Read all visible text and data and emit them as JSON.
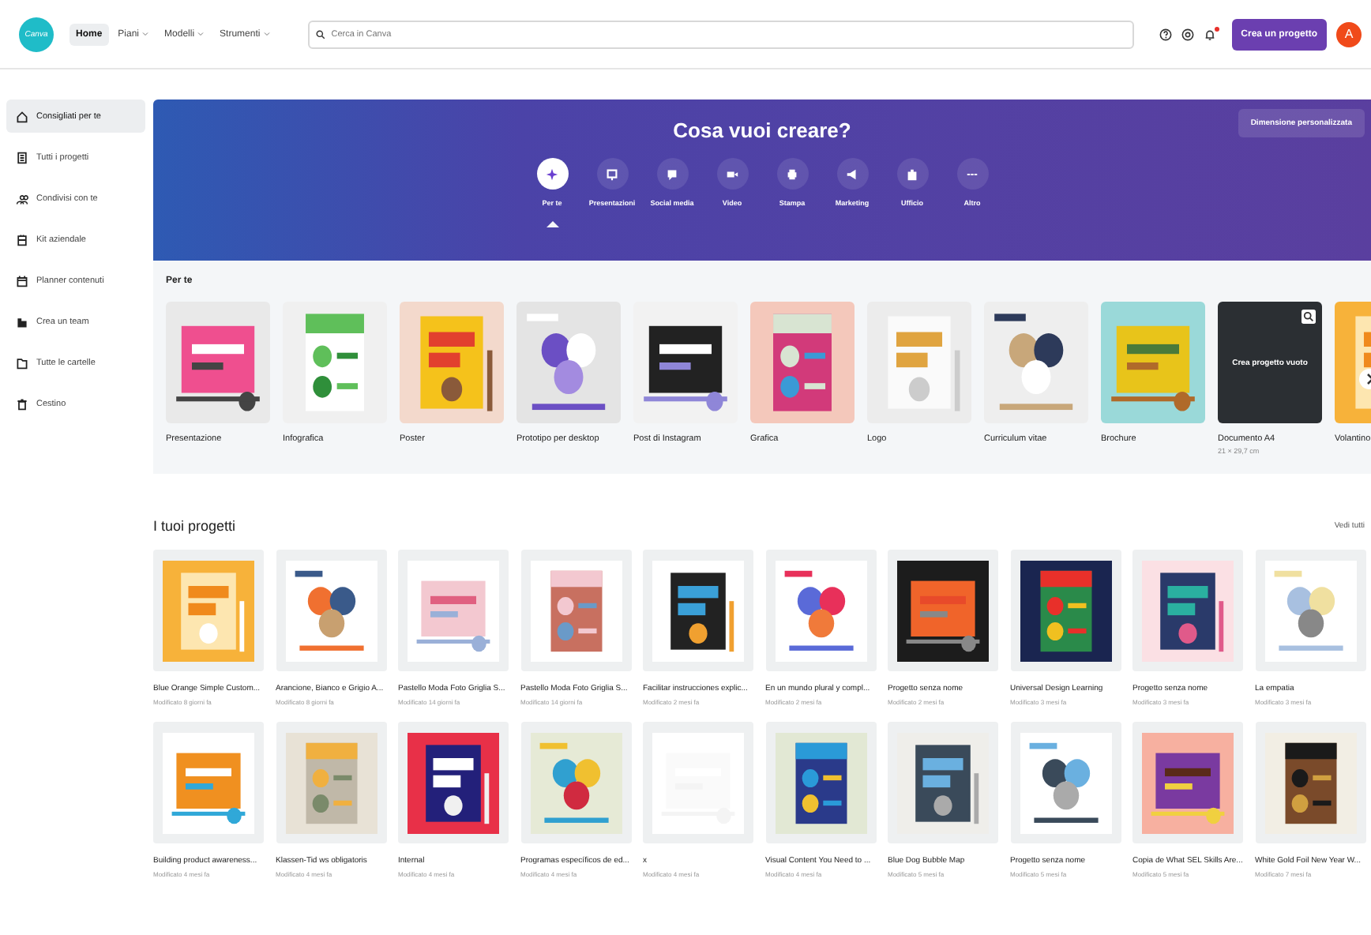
{
  "header": {
    "logo": "Canva",
    "nav": [
      {
        "label": "Home",
        "selected": true,
        "dropdown": false
      },
      {
        "label": "Piani",
        "selected": false,
        "dropdown": true
      },
      {
        "label": "Modelli",
        "selected": false,
        "dropdown": true
      },
      {
        "label": "Strumenti",
        "selected": false,
        "dropdown": true
      }
    ],
    "search": {
      "placeholder": "Cerca in Canva"
    },
    "has_notification": true,
    "create_button": "Crea un progetto",
    "avatar": "A"
  },
  "sidebar": {
    "items": [
      {
        "label": "Consigliati per te",
        "selected": true
      },
      {
        "label": "Tutti i progetti",
        "selected": false
      },
      {
        "label": "Condivisi con te",
        "selected": false
      },
      {
        "label": "Kit aziendale",
        "selected": false
      },
      {
        "label": "Planner contenuti",
        "selected": false
      },
      {
        "label": "Crea un team",
        "selected": false
      },
      {
        "label": "Tutte le cartelle",
        "selected": false
      },
      {
        "label": "Cestino",
        "selected": false
      }
    ]
  },
  "banner": {
    "title": "Cosa vuoi creare?",
    "custom_size_button": "Dimensione personalizzata",
    "categories": [
      {
        "label": "Per te",
        "selected": true
      },
      {
        "label": "Presentazioni",
        "selected": false
      },
      {
        "label": "Social media",
        "selected": false
      },
      {
        "label": "Video",
        "selected": false
      },
      {
        "label": "Stampa",
        "selected": false
      },
      {
        "label": "Marketing",
        "selected": false
      },
      {
        "label": "Ufficio",
        "selected": false
      },
      {
        "label": "Altro",
        "selected": false
      }
    ]
  },
  "for_you": {
    "title": "Per te",
    "designs": [
      {
        "label": "Presentazione",
        "kind": "picture"
      },
      {
        "label": "Infografica",
        "kind": "picture"
      },
      {
        "label": "Poster",
        "kind": "picture"
      },
      {
        "label": "Prototipo per desktop",
        "kind": "picture"
      },
      {
        "label": "Post di Instagram",
        "kind": "picture"
      },
      {
        "label": "Grafica",
        "kind": "picture"
      },
      {
        "label": "Logo",
        "kind": "picture"
      },
      {
        "label": "Curriculum vitae",
        "kind": "picture"
      },
      {
        "label": "Brochure",
        "kind": "picture"
      },
      {
        "label": "Documento A4",
        "kind": "blank",
        "overlay": "Crea progetto vuoto",
        "sub": "21 × 29,7 cm"
      },
      {
        "label": "Volantino",
        "kind": "picture"
      }
    ]
  },
  "projects": {
    "title": "I tuoi progetti",
    "see_all": "Vedi tutti",
    "items": [
      {
        "title": "Blue Orange Simple Custom...",
        "modified": "Modificato 8 giorni fa"
      },
      {
        "title": "Arancione, Bianco e Grigio A...",
        "modified": "Modificato 8 giorni fa"
      },
      {
        "title": "Pastello Moda Foto Griglia S...",
        "modified": "Modificato 14 giorni fa"
      },
      {
        "title": "Pastello Moda Foto Griglia S...",
        "modified": "Modificato 14 giorni fa"
      },
      {
        "title": "Facilitar instrucciones explic...",
        "modified": "Modificato 2 mesi fa"
      },
      {
        "title": "En un mundo plural y compl...",
        "modified": "Modificato 2 mesi fa"
      },
      {
        "title": "Progetto senza nome",
        "modified": "Modificato 2 mesi fa"
      },
      {
        "title": "Universal Design Learning",
        "modified": "Modificato 3 mesi fa"
      },
      {
        "title": "Progetto senza nome",
        "modified": "Modificato 3 mesi fa"
      },
      {
        "title": "La empatia",
        "modified": "Modificato 3 mesi fa"
      },
      {
        "title": "Building product awareness...",
        "modified": "Modificato 4 mesi fa"
      },
      {
        "title": "Klassen-Tid ws obligatoris",
        "modified": "Modificato 4 mesi fa"
      },
      {
        "title": "Internal",
        "modified": "Modificato 4 mesi fa"
      },
      {
        "title": "Programas específicos de ed...",
        "modified": "Modificato 4 mesi fa"
      },
      {
        "title": "x",
        "modified": "Modificato 4 mesi fa"
      },
      {
        "title": "Visual Content You Need to ...",
        "modified": "Modificato 4 mesi fa"
      },
      {
        "title": "Blue Dog Bubble Map",
        "modified": "Modificato 5 mesi fa"
      },
      {
        "title": "Progetto senza nome",
        "modified": "Modificato 5 mesi fa"
      },
      {
        "title": "Copia de What SEL Skills Are...",
        "modified": "Modificato 5 mesi fa"
      },
      {
        "title": "White Gold Foil New Year W...",
        "modified": "Modificato 7 mesi fa"
      }
    ]
  }
}
